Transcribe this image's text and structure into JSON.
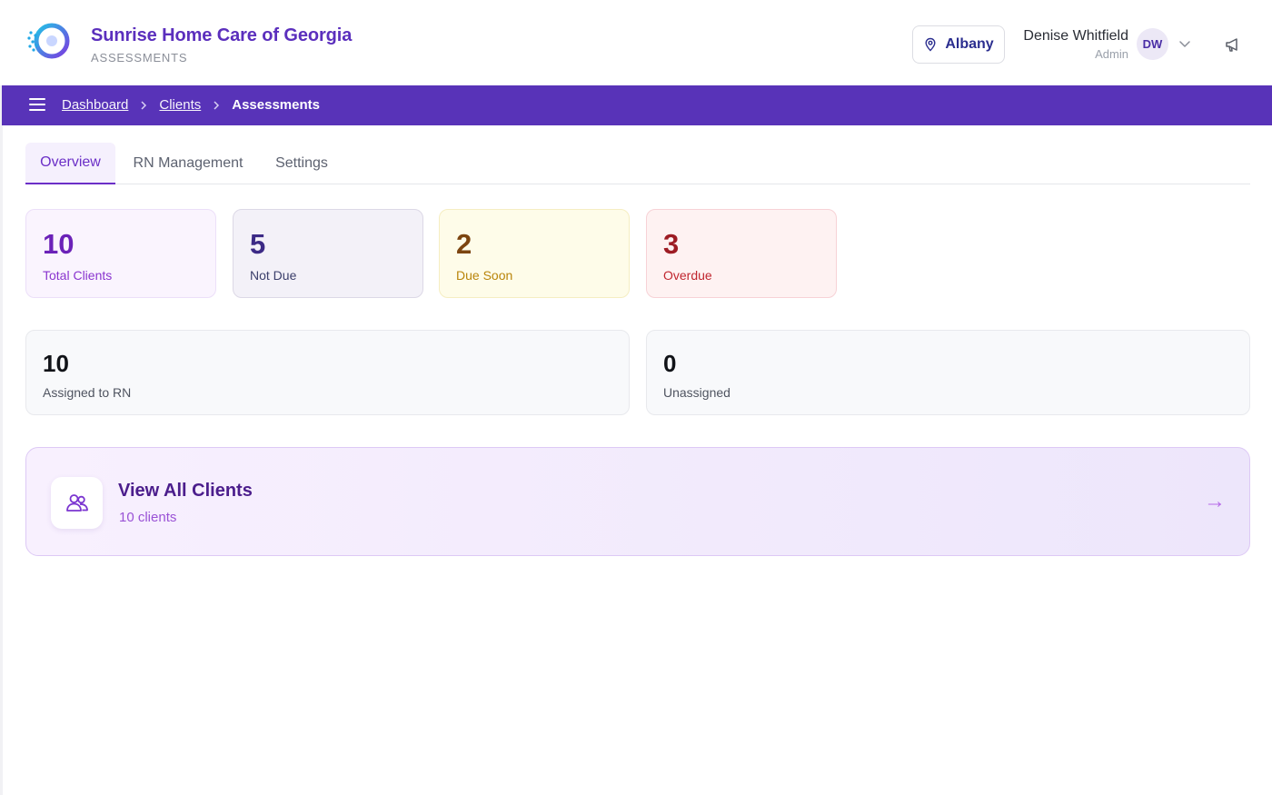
{
  "header": {
    "org_name": "Sunrise Home Care of Georgia",
    "section": "ASSESSMENTS",
    "location": "Albany",
    "user_name": "Denise Whitfield",
    "user_role": "Admin",
    "user_initials": "DW",
    "icons": {
      "location": "map-pin-icon",
      "menu": "chevron-down-icon",
      "announce": "megaphone-icon"
    }
  },
  "breadcrumb": {
    "items": [
      {
        "label": "Dashboard"
      },
      {
        "label": "Clients"
      }
    ],
    "current": "Assessments",
    "separator": ">"
  },
  "tabs": [
    {
      "label": "Overview",
      "active": true
    },
    {
      "label": "RN Management",
      "active": false
    },
    {
      "label": "Settings",
      "active": false
    }
  ],
  "stats": [
    {
      "value": "10",
      "label": "Total Clients"
    },
    {
      "value": "5",
      "label": "Not Due"
    },
    {
      "value": "2",
      "label": "Due Soon"
    },
    {
      "value": "3",
      "label": "Overdue"
    }
  ],
  "assignment": [
    {
      "value": "10",
      "label": "Assigned to RN"
    },
    {
      "value": "0",
      "label": "Unassigned"
    }
  ],
  "view_all": {
    "title": "View All Clients",
    "subtitle": "10 clients",
    "arrow": "→"
  },
  "colors": {
    "brand": "#5b2fbd",
    "bar": "#5833b8",
    "accent": "#6b2fc7"
  }
}
